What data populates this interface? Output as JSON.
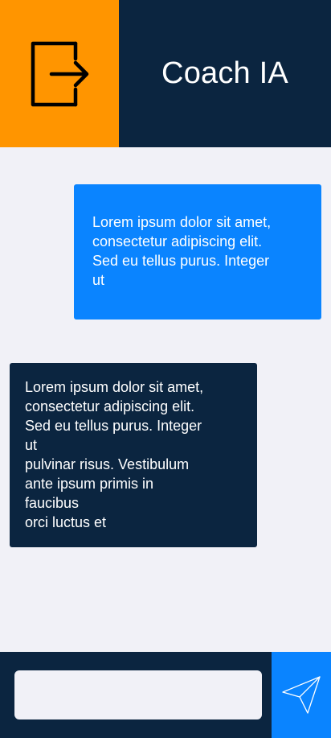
{
  "header": {
    "title": "Coach IA",
    "logout_icon": "logout-icon"
  },
  "messages": [
    {
      "role": "user",
      "text": "Lorem ipsum dolor sit amet,\nconsectetur adipiscing elit.\nSed eu tellus purus. Integer\nut"
    },
    {
      "role": "assistant",
      "text": "Lorem ipsum dolor sit amet,\nconsectetur adipiscing elit.\nSed eu tellus purus. Integer\nut\npulvinar risus. Vestibulum\nante ipsum primis in\nfaucibus\norci luctus et"
    }
  ],
  "composer": {
    "input_value": "",
    "placeholder": "",
    "send_icon": "send-icon"
  },
  "colors": {
    "navy": "#0b2540",
    "orange": "#ff9500",
    "blue": "#0a84ff",
    "background": "#f1f1f7"
  }
}
